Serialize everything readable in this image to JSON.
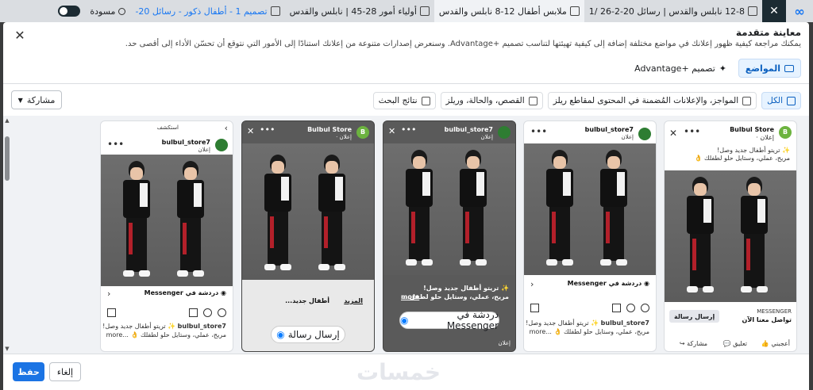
{
  "topbar": {
    "campaign": "12-8 نابلس والقدس | رسائل 20-2-26 /1",
    "adset": "ملابس أطفال 12-8 نابلس والقدس",
    "audience": "أولياء أمور 28-45 | نابلس والقدس",
    "design": "تصميم 1 - أطفال ذكور - رسائل 20-",
    "draft": "مسودة"
  },
  "modal": {
    "title": "معاينة متقدمة",
    "subtitle": "يمكنك مراجعة كيفية ظهور إعلانك في مواضع مختلفة إضافة إلى كيفية تهيئتها لتناسب تصميم +Advantage. وسنعرض إصدارات متنوعة من إعلانك استنادًا إلى الأمور التي نتوقع أن تحسّن الأداء إلى أقصى حد.",
    "placements_button": "المواضع",
    "advantage_button": "تصميم +Advantage",
    "filters": [
      "الكل",
      "المواجز، والإعلانات المُضمنة في المحتوى لمقاطع ريلز",
      "القصص، والحالة، وريلز",
      "نتائج البحث"
    ],
    "share_label": "مشاركة"
  },
  "cards": {
    "feed": {
      "page_name": "Bulbul Store",
      "sponsored": "إعلان ·",
      "line1": "✨ تريتو أطفال جديد وصل!",
      "line2": "مريح، عملي، وستايل حلو لطفلك 👌",
      "cta_label": "MESSENGER",
      "cta_sub": "تواصل معنا الآن",
      "cta_button": "إرسال رسالة",
      "like": "أعجبني",
      "comment": "تعليق",
      "share": "مشاركة"
    },
    "ig_feed": {
      "page_name": "bulbul_store7",
      "sponsored": "إعلان",
      "cta": "دردشة في Messenger",
      "caption_name": "bulbul_store7",
      "caption": "✨ تريتو أطفال جديد وصل!",
      "caption2": "مريح، عملي، وستايل حلو لطفلك 👌 ...more"
    },
    "ig_story": {
      "page_name": "bulbul_store7",
      "sponsored": "إعلان",
      "line1": "✨ تريتو أطفال جديد وصل!",
      "line2": "مريح، عملي، وستايل حلو لطفل...",
      "more": "more",
      "cta": "دردشة في Messenger",
      "footer": "إعلان"
    },
    "fb_story": {
      "page_name": "Bulbul Store",
      "sponsored": "إعلان ·",
      "text": "أطفال جديد...",
      "more": "المزيد",
      "cta": "إرسال رسالة"
    },
    "ig_explore": {
      "header": "استكشف",
      "page_name": "bulbul_store7",
      "sponsored": "إعلان",
      "cta": "دردشة في Messenger",
      "caption_name": "bulbul_store7",
      "caption": "✨ تريتو أطفال جديد وصل!",
      "caption2": "مريح، عملي، وستايل حلو لطفلك 👌 ...more"
    }
  },
  "footer": {
    "save": "حفظ",
    "cancel": "إلغاء",
    "watermark": "خمسات"
  }
}
